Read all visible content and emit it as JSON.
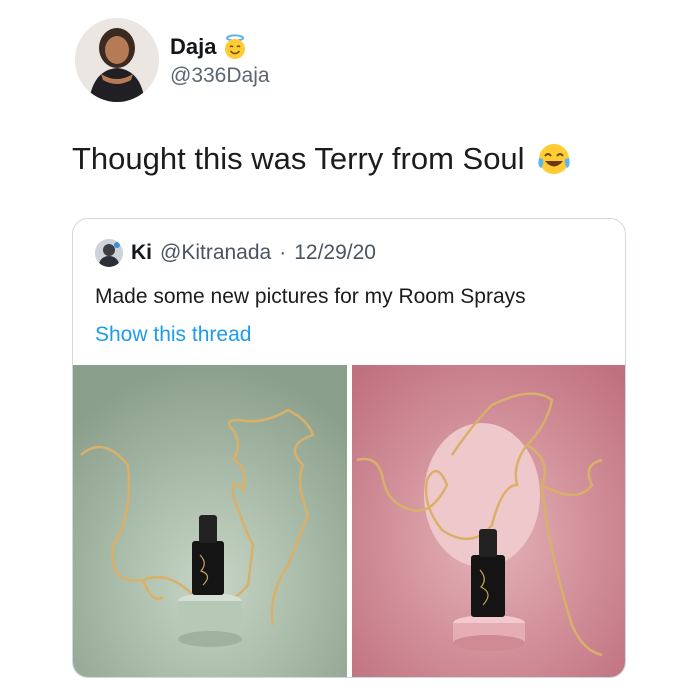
{
  "author": {
    "name": "Daja",
    "handle": "@336Daja",
    "badge_icon": "smiling-face-with-halo"
  },
  "tweet": {
    "text": "Thought this was Terry from Soul",
    "emoji_icon": "face-with-tears-of-joy"
  },
  "quoted_tweet": {
    "name": "Ki",
    "handle": "@Kitranada",
    "separator": "·",
    "date": "12/29/20",
    "text": "Made some new pictures for my Room Sprays",
    "link": "Show this thread",
    "link_color": "#1d9bf0",
    "photos": [
      {
        "background": "#9aae9b",
        "description": "room-spray-bottle-green"
      },
      {
        "background": "#c98a94",
        "description": "room-spray-bottle-pink"
      }
    ]
  }
}
